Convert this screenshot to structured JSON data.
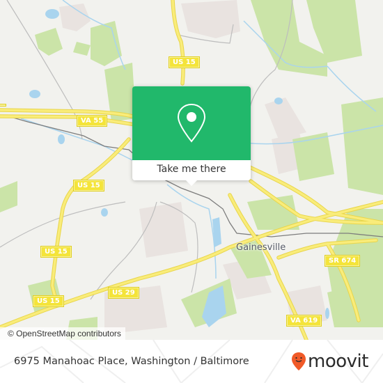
{
  "map": {
    "attribution": "© OpenStreetMap contributors",
    "place_labels": [
      {
        "name": "Gainesville"
      }
    ],
    "road_shields": [
      {
        "label": "US 15"
      },
      {
        "label": "VA 55"
      },
      {
        "label": "US 15"
      },
      {
        "label": "US 15"
      },
      {
        "label": "US 15"
      },
      {
        "label": "US 29"
      },
      {
        "label": "SR 674"
      },
      {
        "label": "VA 619"
      }
    ],
    "colors": {
      "background": "#f2f2ee",
      "park": "#c8e3a5",
      "water": "#a9d4ee",
      "major_road": "#f6e261",
      "residential": "#e8e1df",
      "railway": "#7a7a7a"
    }
  },
  "popup": {
    "icon": "map-pin-icon",
    "action_label": "Take me there",
    "color": "#21b86b"
  },
  "footer": {
    "address": "6975 Manahoac Place, Washington / Baltimore",
    "brand": "moovit",
    "brand_icon": "moovit-smiley-pin-icon",
    "brand_color": "#f05a28"
  }
}
